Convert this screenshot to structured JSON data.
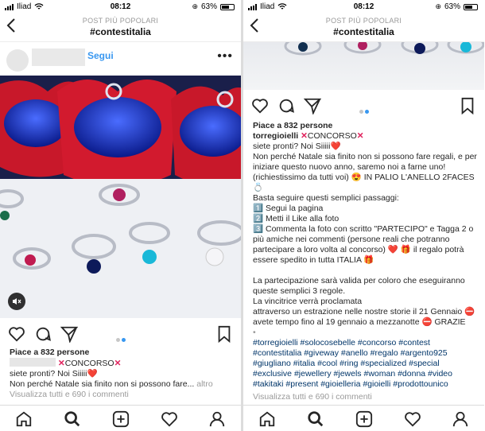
{
  "status": {
    "carrier": "Iliad",
    "time": "08:12",
    "battery": "63%",
    "battery_level": 0.63
  },
  "header": {
    "subtitle": "POST PIÙ POPOLARI",
    "title": "#contestitalia"
  },
  "left_post": {
    "follow_label": "Segui",
    "more_label": "•••",
    "likes": "Piace a 832 persone",
    "caption_tail": "CONCORSO",
    "line2": "siete pronti? Noi Siiiii",
    "line3": "Non perché Natale sia finito non si possono fare...",
    "more": "altro",
    "comments": "Visualizza tutti e 690 i commenti"
  },
  "right_post": {
    "likes": "Piace a 832 persone",
    "username": "torregioielli",
    "concorso": "CONCORSO",
    "lines": [
      "siete pronti? Noi Siiiii",
      "Non perché Natale sia finito non si possono fare regali, e per iniziare questo nuovo anno, saremo noi a farne uno! (richiestissimo da tutti voi) 😍 IN PALIO L'ANELLO 2FACES 💍",
      "Basta seguire questi semplici passaggi:",
      "1️⃣ Segui la pagina",
      "2️⃣ Metti il Like alla foto",
      "3️⃣ Commenta la foto con scritto \"PARTECIPO\" e Tagga 2 o più amiche nei commenti (persone reali che potranno partecipare a loro volta al concorso) ❤️ 🎁 il regalo potrà essere spedito in tutta ITALIA 🎁",
      "",
      "La partecipazione sarà valida per coloro che eseguiranno queste semplici 3 regole.",
      "La vincitrice verrà proclamata",
      "attraverso un estrazione nelle nostre storie il 21 Gennaio ⛔ avete tempo fino al 19 gennaio a mezzanotte ⛔ GRAZIE"
    ],
    "separator": "•",
    "hashtags": "#torregioielli #solocosebelle #concorso #contest #contestitalia #giveway #anello #regalo #argento925 #giugliano #italia #cool #ring #specialized #special #exclusive #jewellery #jewels #woman #donna #video #takitaki #present #gioielleria #gioielli #prodottounico",
    "comments": "Visualizza tutti e 690 i commenti"
  },
  "icons": {
    "back": "chevron-left-icon",
    "like": "heart-icon",
    "comment": "comment-icon",
    "share": "send-icon",
    "save": "bookmark-icon",
    "mute": "speaker-off-icon",
    "tabs": [
      "home-icon",
      "search-icon",
      "add-icon",
      "activity-icon",
      "profile-icon"
    ]
  },
  "colors": {
    "accent": "#3897f0",
    "alert": "#e0245e",
    "hashtag": "#003569"
  }
}
